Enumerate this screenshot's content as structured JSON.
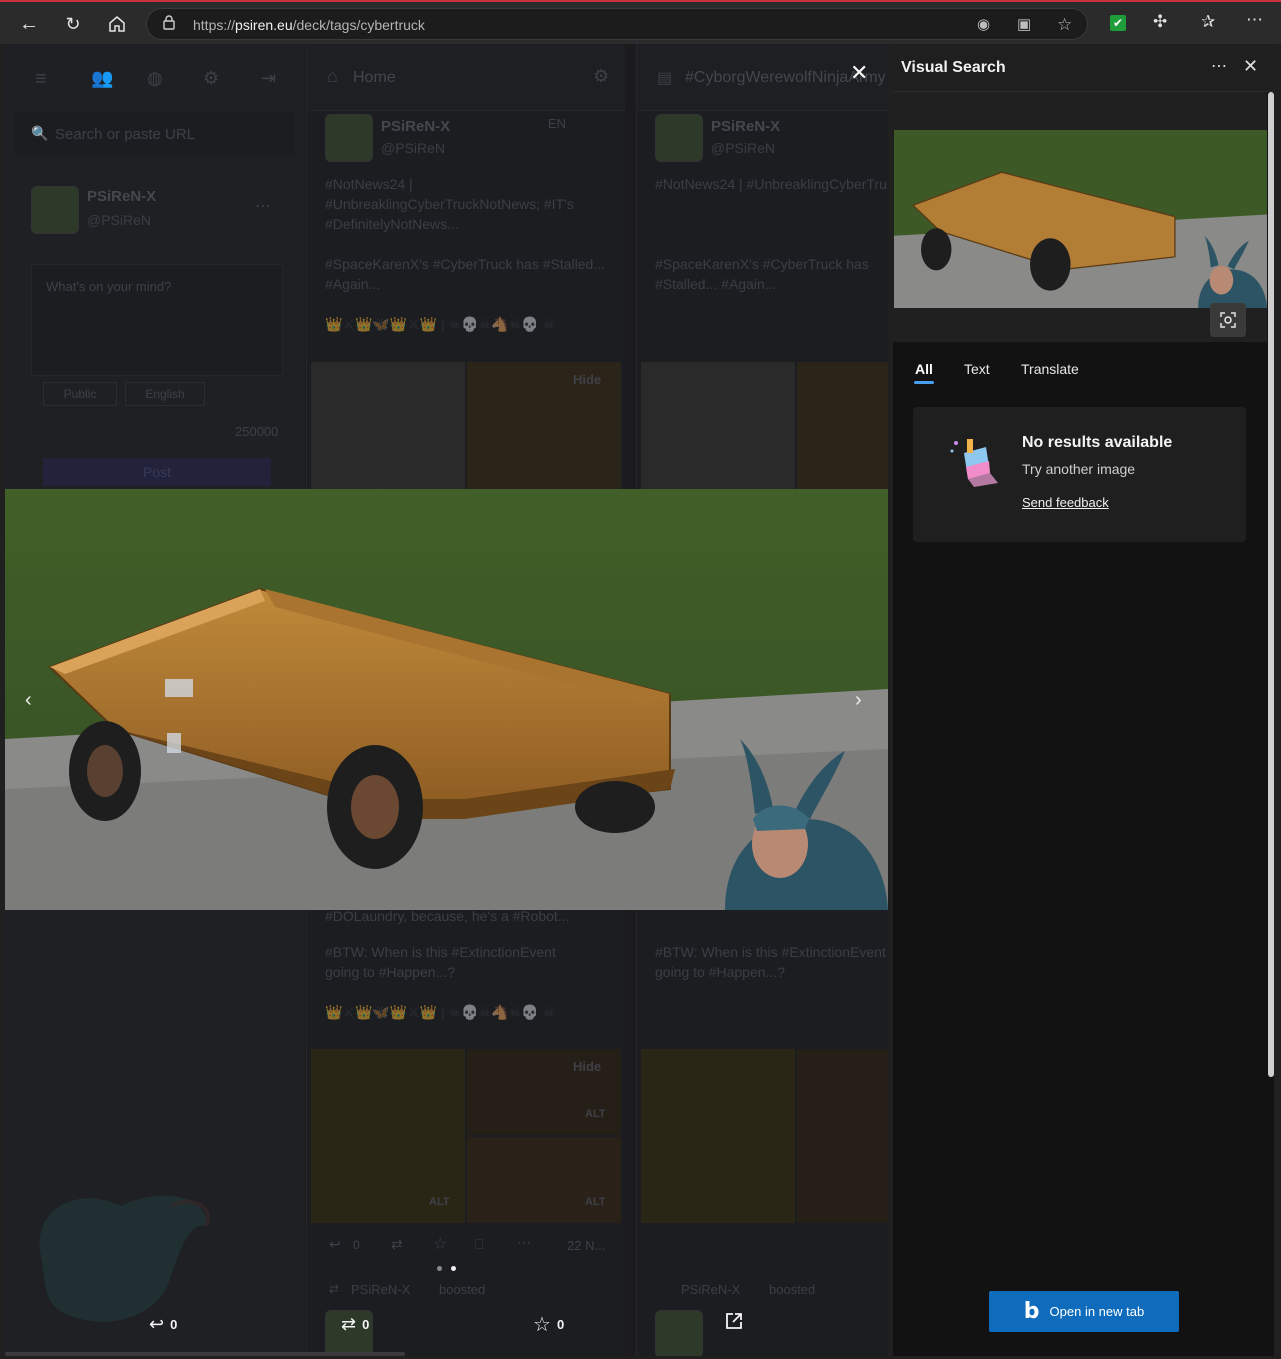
{
  "browser": {
    "url_prefix": "https://",
    "url_domain": "psiren.eu",
    "url_path": "/deck/tags/cybertruck"
  },
  "page": {
    "search_placeholder": "Search or paste URL",
    "compose_placeholder": "What's on your mind?",
    "visibility": "Public",
    "language": "English",
    "char_count": "250000",
    "post_button": "Post",
    "account": {
      "name": "PSiReN-X",
      "handle": "@PSiReN"
    },
    "columns": [
      {
        "title": "Home"
      },
      {
        "title": "#CyborgWerewolfNinjaArmy"
      }
    ],
    "posts": [
      {
        "name": "PSiReN-X",
        "handle": "@PSiReN",
        "lang": "EN",
        "text1": "#NotNews24 | #UnbreaklingCyberTruckNotNews; #IT's #DefinitelyNotNews...",
        "text2": "#SpaceKarenX's #CyberTruck has #Stalled... #Again...",
        "emoji": "👑⚔👑🦋👑⚔👑 | ☠💀☠🐴☠💀 ☠",
        "hide": "Hide"
      },
      {
        "text0": "#DOLaundry, because, he's a #Robot...",
        "text1": "#BTW: When is this #ExtinctionEvent going to #Happen...?",
        "emoji": "👑⚔👑🦋👑⚔👑 | ☠💀☠🐴☠💀 ☠",
        "hide": "Hide",
        "alt": "ALT",
        "time": "22 N...",
        "reply_count": "0"
      }
    ],
    "boost_line": {
      "name": "PSiReN-X",
      "action": "boosted"
    }
  },
  "lightbox": {
    "reply_count": "0",
    "boost_count": "0",
    "fav_count": "0",
    "page_index": 2,
    "page_total": 2
  },
  "visual_search": {
    "title": "Visual Search",
    "tabs": [
      "All",
      "Text",
      "Translate"
    ],
    "active_tab": "All",
    "no_results": "No results available",
    "try_another": "Try another image",
    "send_feedback": "Send feedback",
    "open_new_tab": "Open in new tab"
  },
  "colors": {
    "accent_red": "#c8303c",
    "bing_blue": "#0f6cbd",
    "tab_underline": "#4aa0f0",
    "extension_green": "#1f9d3a"
  },
  "icons": [
    "back-icon",
    "refresh-icon",
    "home-icon",
    "lock-icon",
    "hide-icon",
    "reader-icon",
    "favorite-star-icon",
    "extension-icon",
    "puzzle-icon",
    "favorites-icon",
    "more-icon",
    "close-icon",
    "crop-search-icon",
    "bing-icon",
    "reply-icon",
    "boost-icon",
    "star-icon",
    "external-link-icon",
    "chevron-left-icon",
    "chevron-right-icon"
  ]
}
